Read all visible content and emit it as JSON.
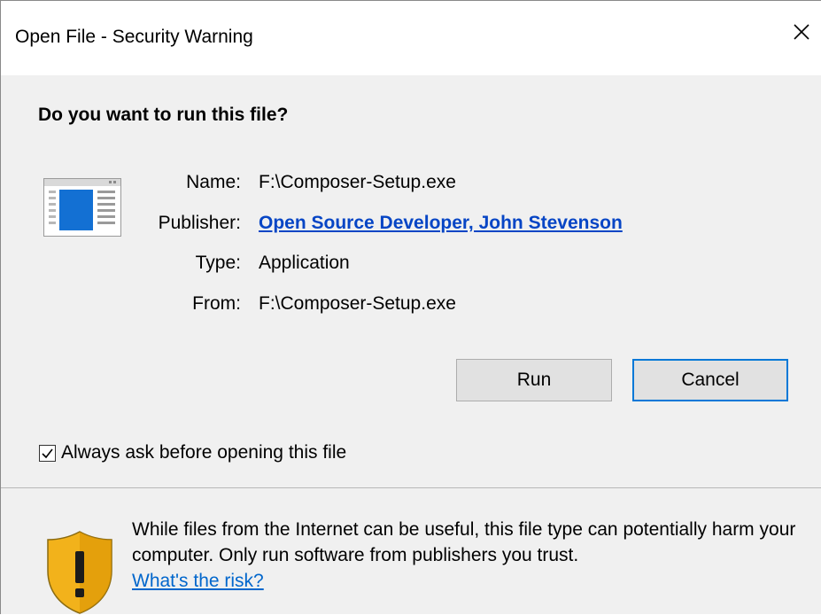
{
  "window": {
    "title": "Open File - Security Warning",
    "close_icon": "close-icon"
  },
  "prompt": {
    "question": "Do you want to run this file?"
  },
  "file_info": {
    "icon": "application-window-icon",
    "name_label": "Name:",
    "name_value": "F:\\Composer-Setup.exe",
    "publisher_label": "Publisher:",
    "publisher_value": "Open Source Developer, John Stevenson",
    "type_label": "Type:",
    "type_value": "Application",
    "from_label": "From:",
    "from_value": "F:\\Composer-Setup.exe"
  },
  "buttons": {
    "run": "Run",
    "cancel": "Cancel"
  },
  "options": {
    "always_ask_label": "Always ask before opening this file",
    "always_ask_checked": true
  },
  "warning": {
    "icon": "shield-warning-icon",
    "text": "While files from the Internet can be useful, this file type can potentially harm your computer. Only run software from publishers you trust.",
    "link": "What's the risk?"
  },
  "colors": {
    "link": "#0645c5",
    "focus_border": "#0078d7",
    "shield": "#f2b21b"
  }
}
